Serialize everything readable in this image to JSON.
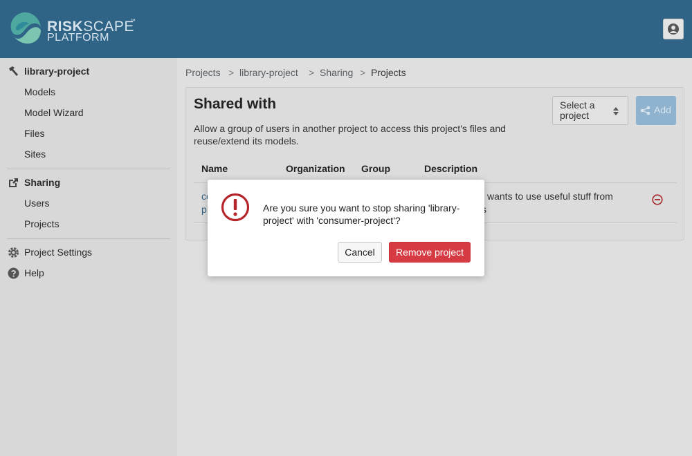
{
  "header": {
    "logo_word_bold": "RISK",
    "logo_word_light": "SCAPE",
    "logo_line2": "PLATFORM",
    "logo_tm": "™",
    "user_icon": "user-icon"
  },
  "sidebar": {
    "project": {
      "label": "library-project",
      "icon": "hammer-icon"
    },
    "project_items": [
      "Models",
      "Model Wizard",
      "Files",
      "Sites"
    ],
    "sharing": {
      "label": "Sharing",
      "icon": "external-link-icon"
    },
    "sharing_items": [
      "Users",
      "Projects"
    ],
    "settings": {
      "label": "Project Settings",
      "icon": "gear-icon"
    },
    "help": {
      "label": "Help",
      "icon": "question-circle-icon"
    }
  },
  "breadcrumb": {
    "items": [
      "Projects",
      "library-project",
      "Sharing"
    ],
    "separator": ">",
    "current": "Projects"
  },
  "card": {
    "title": "Shared with",
    "description": "Allow a group of users in another project to access this project's files and reuse/extend its models.",
    "select_placeholder": "Select a project",
    "add_label": "Add",
    "columns": [
      "Name",
      "Organization",
      "Group",
      "Description"
    ],
    "row": {
      "name_line1": "co",
      "name_line2": "p",
      "description_line1": "wants to use useful stuff from",
      "description_line2": "s"
    }
  },
  "modal": {
    "message": "Are you sure you want to stop sharing 'library-project' with 'consumer-project'?",
    "cancel_label": "Cancel",
    "confirm_label": "Remove project",
    "icon": "warning-circle-icon"
  },
  "colors": {
    "header_bg": "#2f6487",
    "danger": "#d63a42",
    "icon_red": "#b5262c",
    "primary_disabled": "#8fb3cf"
  }
}
